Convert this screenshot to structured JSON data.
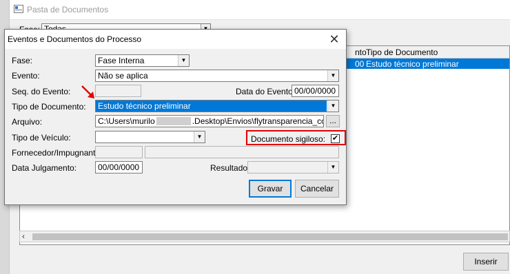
{
  "background_window": {
    "title": "Pasta de Documentos",
    "fase_label": "Fase:",
    "fase_value": "Todas",
    "grid": {
      "headers": [
        "nto",
        "Tipo de Documento"
      ],
      "rows": [
        [
          "00",
          "Estudo técnico preliminar"
        ]
      ]
    },
    "inserir_button": "Inserir"
  },
  "dialog": {
    "title": "Eventos e Documentos do Processo",
    "labels": {
      "fase": "Fase:",
      "evento": "Evento:",
      "seq_evento": "Seq. do Evento:",
      "data_evento": "Data do Evento:",
      "tipo_documento": "Tipo de Documento:",
      "arquivo": "Arquivo:",
      "tipo_veiculo": "Tipo de Veículo:",
      "documento_sigiloso": "Documento sigiloso:",
      "fornecedor": "Fornecedor/Impugnante:",
      "data_julgamento": "Data Julgamento:",
      "resultado": "Resultado:"
    },
    "values": {
      "fase": "Fase Interna",
      "evento": "Não se aplica",
      "seq_evento": "",
      "data_evento": "00/00/0000",
      "tipo_documento": "Estudo técnico preliminar",
      "arquivo_prefix": "C:\\Users\\murilo",
      "arquivo_suffix": ".Desktop\\Envios\\flytransparencia_compras",
      "tipo_veiculo": "",
      "documento_sigiloso_checked": "✔",
      "fornecedor_code": "",
      "fornecedor_name": "",
      "data_julgamento": "00/00/0000",
      "resultado": ""
    },
    "browse_button": "...",
    "buttons": {
      "gravar": "Gravar",
      "cancelar": "Cancelar"
    },
    "close_glyph": "✕"
  },
  "colors": {
    "selection": "#0078d7",
    "annotation": "#e00000"
  }
}
